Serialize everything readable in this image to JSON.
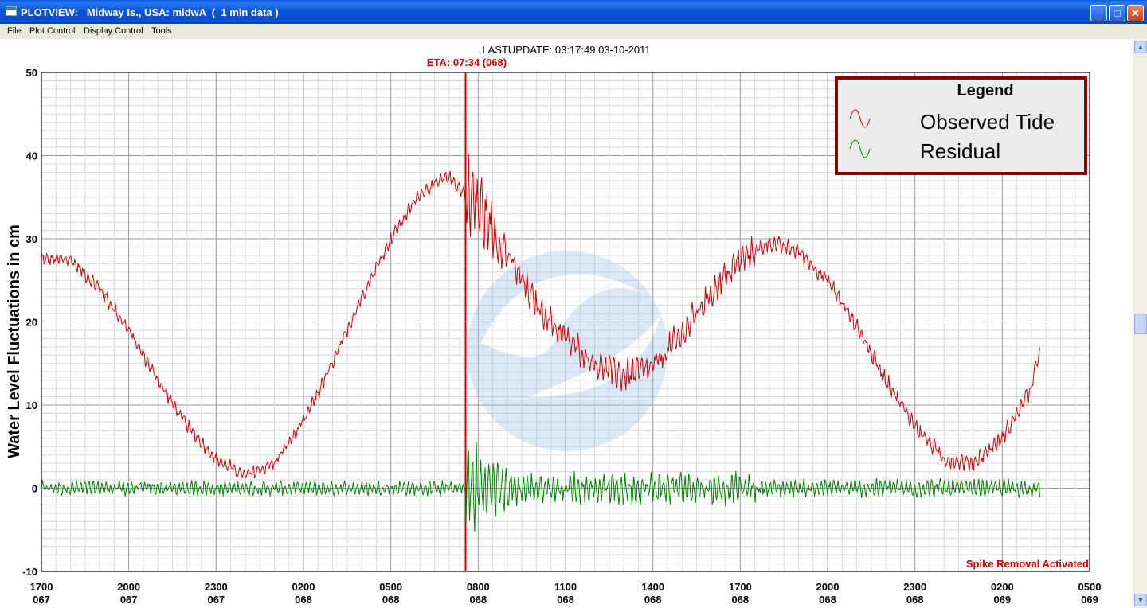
{
  "window": {
    "title": "PLOTVIEW:   Midway Is., USA: midwA  (  1 min data )",
    "buttons": {
      "minimize": "_",
      "maximize": "□",
      "close": "✕"
    }
  },
  "menu": [
    "File",
    "Plot Control",
    "Display Control",
    "Tools"
  ],
  "chart_data": {
    "type": "line",
    "title": "LASTUPDATE: 03:17:49  03-10-2011",
    "eta_label": "ETA: 07:34 (068)",
    "eta_hour": 14.567,
    "ylabel": "Water Level Fluctuations in cm",
    "ylim": [
      -10,
      50
    ],
    "xlim": [
      0,
      36
    ],
    "x_unit": "hours since 1700 (day 067)",
    "y_ticks": [
      "50",
      "40",
      "30",
      "20",
      "10",
      "0",
      "-10"
    ],
    "x_ticks": [
      {
        "time": "1700",
        "day": "067"
      },
      {
        "time": "2000",
        "day": "067"
      },
      {
        "time": "2300",
        "day": "067"
      },
      {
        "time": "0200",
        "day": "068"
      },
      {
        "time": "0500",
        "day": "068"
      },
      {
        "time": "0800",
        "day": "068"
      },
      {
        "time": "1100",
        "day": "068"
      },
      {
        "time": "1400",
        "day": "068"
      },
      {
        "time": "1700",
        "day": "068"
      },
      {
        "time": "2000",
        "day": "068"
      },
      {
        "time": "2300",
        "day": "068"
      },
      {
        "time": "0200",
        "day": "069"
      },
      {
        "time": "0500",
        "day": "069"
      }
    ],
    "legend": {
      "title": "Legend",
      "position": "top-right",
      "entries": [
        "Observed Tide",
        "Residual"
      ]
    },
    "annotation": "Spike Removal Activated",
    "series": [
      {
        "name": "Observed Tide",
        "color": "#cc0000",
        "x": [
          0,
          1,
          2,
          3,
          4,
          5,
          6,
          7,
          8,
          9,
          10,
          11,
          12,
          13,
          14,
          14.5,
          15,
          16,
          17,
          18,
          19,
          20,
          21,
          22,
          23,
          24,
          25,
          26,
          27,
          28,
          29,
          30,
          31,
          32,
          33,
          34,
          34.3
        ],
        "y": [
          27.5,
          27.5,
          24,
          19,
          13,
          7.5,
          3.5,
          1.5,
          3,
          8,
          15,
          23,
          30,
          35.5,
          37.5,
          35.5,
          34,
          28,
          22,
          18,
          15,
          13.5,
          14.5,
          18.5,
          23.5,
          27.5,
          29.5,
          28.5,
          25,
          19.5,
          13,
          7.5,
          3.5,
          3,
          6,
          12,
          17
        ]
      },
      {
        "name": "Residual",
        "color": "#008000",
        "x": [
          0,
          34.3
        ],
        "y": [
          0,
          0
        ]
      }
    ]
  }
}
